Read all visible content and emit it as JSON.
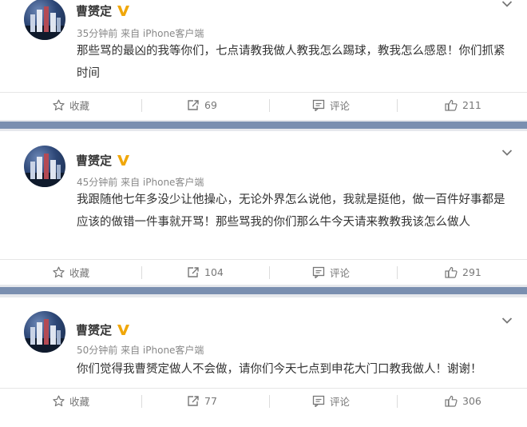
{
  "posts": [
    {
      "author": "曹赟定",
      "time": "35分钟前",
      "source": "来自 iPhone客户端",
      "text": "那些骂的最凶的我等你们，七点请教我做人教我怎么踢球，教我怎么感恩！你们抓紧时间",
      "favorite_label": "收藏",
      "repost_count": "69",
      "comment_label": "评论",
      "like_count": "211"
    },
    {
      "author": "曹赟定",
      "time": "45分钟前",
      "source": "来自 iPhone客户端",
      "text": "我跟随他七年多没少让他操心，无论外界怎么说他，我就是挺他，做一百件好事都是应该的做错一件事就开骂！那些骂我的你们那么牛今天请来教教我该怎么做人",
      "favorite_label": "收藏",
      "repost_count": "104",
      "comment_label": "评论",
      "like_count": "291"
    },
    {
      "author": "曹赟定",
      "time": "50分钟前",
      "source": "来自 iPhone客户端",
      "text": "你们觉得我曹赟定做人不会做，请你们今天七点到申花大门口教我做人！谢谢！",
      "favorite_label": "收藏",
      "repost_count": "77",
      "comment_label": "评论",
      "like_count": "306"
    }
  ],
  "icons": {
    "verified_badge": "verified-v-icon",
    "favorite": "star-icon",
    "repost": "repost-icon",
    "comment": "comment-icon",
    "like": "thumbs-up-icon",
    "more": "chevron-down-icon"
  },
  "colors": {
    "verified_badge": "#f0a70a",
    "separator_band": "#7a8fb0",
    "text": "#333333",
    "meta": "#888888"
  }
}
